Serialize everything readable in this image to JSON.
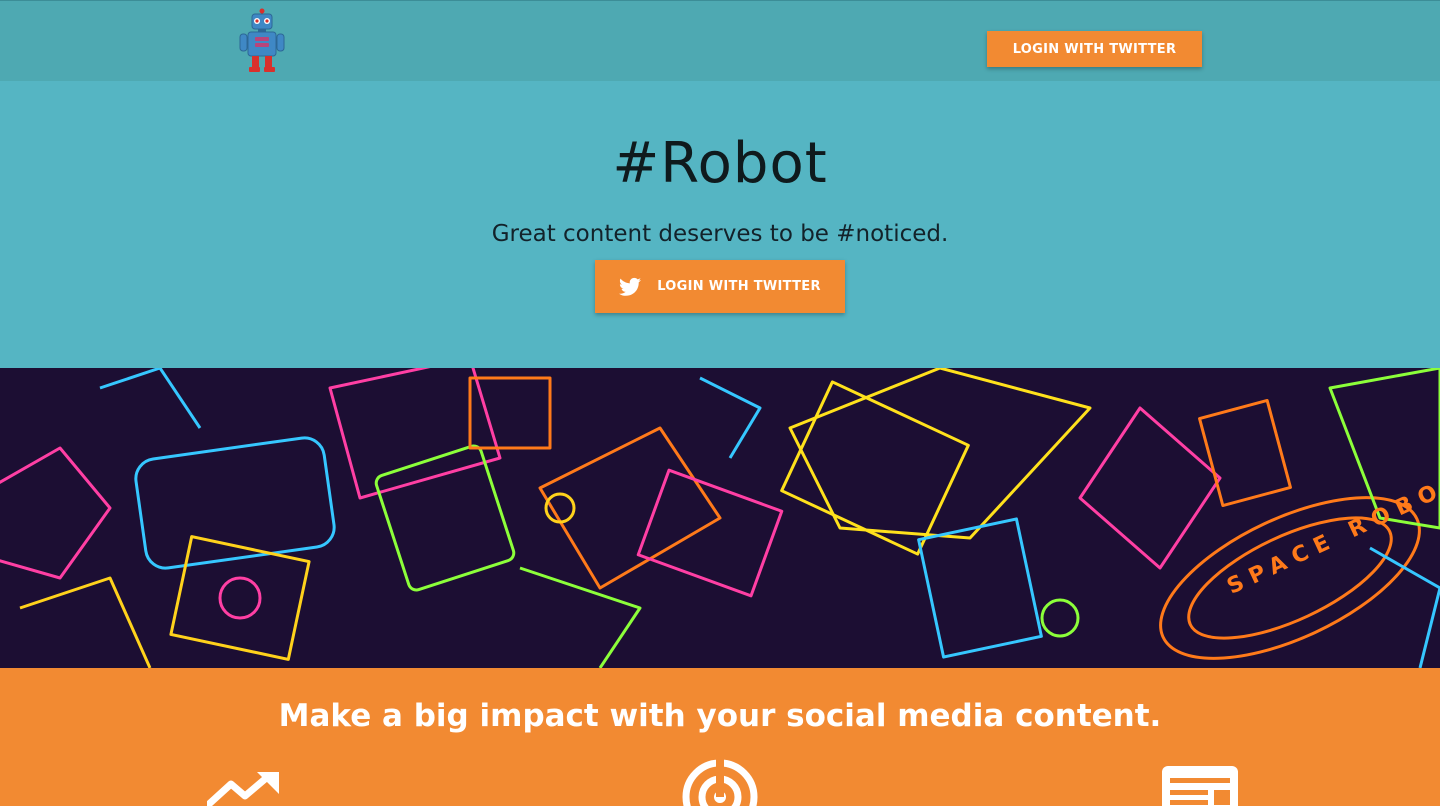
{
  "header": {
    "logo_icon": "robot-logo-icon",
    "login_label": "LOGIN WITH TWITTER"
  },
  "hero": {
    "title": "#Robot",
    "tagline": "Great content deserves to be #noticed.",
    "login_label": "LOGIN WITH TWITTER",
    "login_icon": "twitter-bird-icon"
  },
  "banner": {
    "image": "neon-robots-illustration",
    "text": "SPACE ROBO"
  },
  "impact": {
    "title": "Make a big impact with your social media content.",
    "features": [
      {
        "icon": "trending-up-icon"
      },
      {
        "icon": "radar-icon"
      },
      {
        "icon": "newspaper-icon"
      }
    ]
  },
  "colors": {
    "topbar": "#4ea9b2",
    "hero_bg": "#55b5c3",
    "accent_orange": "#f28a32",
    "banner_bg": "#1c0e33"
  }
}
